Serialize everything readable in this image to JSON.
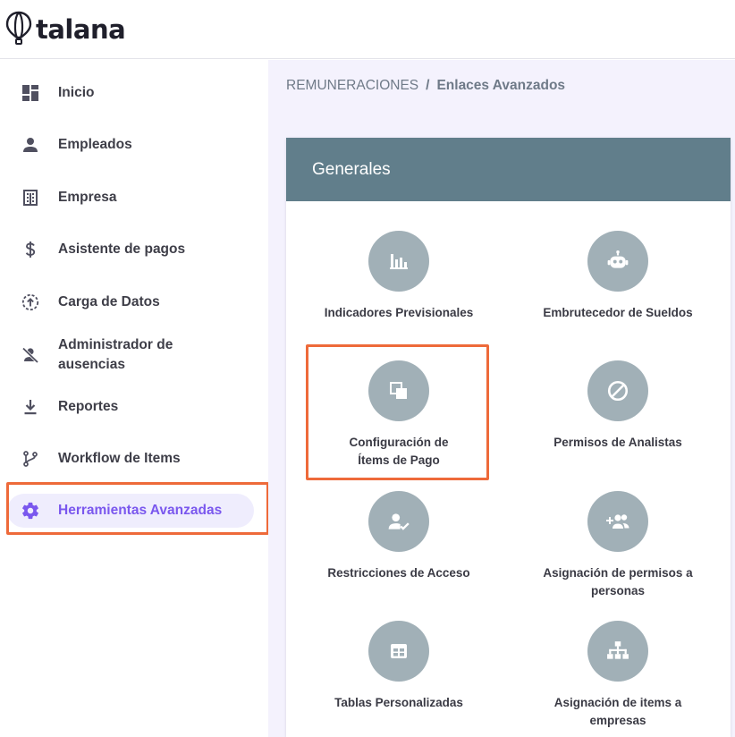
{
  "app": {
    "logo_text": "talana"
  },
  "sidebar": {
    "items": [
      {
        "label": "Inicio",
        "icon": "dashboard-icon"
      },
      {
        "label": "Empleados",
        "icon": "person-icon"
      },
      {
        "label": "Empresa",
        "icon": "building-icon"
      },
      {
        "label": "Asistente de pagos",
        "icon": "dollar-icon"
      },
      {
        "label": "Carga de Datos",
        "icon": "upload-circle-icon"
      },
      {
        "label": "Administrador de ausencias",
        "icon": "person-off-icon"
      },
      {
        "label": "Reportes",
        "icon": "download-icon"
      },
      {
        "label": "Workflow de Items",
        "icon": "branch-icon"
      },
      {
        "label": "Herramientas Avanzadas",
        "icon": "gear-icon",
        "active": true
      }
    ]
  },
  "breadcrumb": {
    "root": "REMUNERACIONES",
    "separator": "/",
    "current": "Enlaces Avanzados"
  },
  "card": {
    "title": "Generales",
    "tiles": [
      {
        "label": "Indicadores Previsionales",
        "icon": "bar-chart-icon"
      },
      {
        "label": "Embrutecedor de Sueldos",
        "icon": "robot-icon"
      },
      {
        "label": "Configuración de Ítems de Pago",
        "icon": "copy-squares-icon"
      },
      {
        "label": "Permisos de Analistas",
        "icon": "block-icon"
      },
      {
        "label": "Restricciones de Acceso",
        "icon": "person-check-icon"
      },
      {
        "label": "Asignación de permisos a personas",
        "icon": "group-add-icon"
      },
      {
        "label": "Tablas Personalizadas",
        "icon": "table-icon"
      },
      {
        "label": "Asignación de items a empresas",
        "icon": "hierarchy-icon"
      }
    ]
  },
  "colors": {
    "accent": "#7a57ee",
    "active_bg": "#efedfd",
    "highlight": "#ee6a3a",
    "header_bg": "#617e8b",
    "tile_circle": "#a1b0b7",
    "main_bg": "#f4f2fd"
  }
}
